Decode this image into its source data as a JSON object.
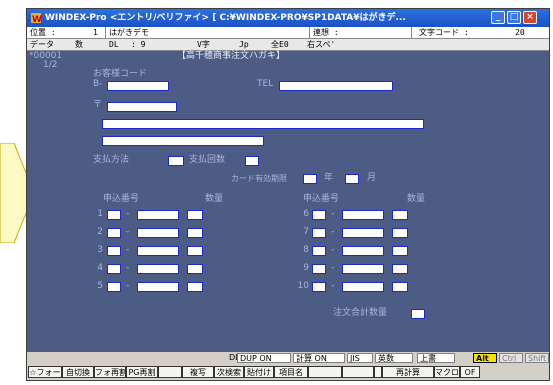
{
  "window": {
    "title": "WINDEX-Pro <エントリ/ベリファイ> [ C:¥WINDEX-PRO¥SP1DATA¥はがきデ...",
    "min": "_",
    "max": "□",
    "close": "×"
  },
  "header_row1": {
    "pos_label": "位置 :",
    "pos_value": "1",
    "pos_name": "はがきデモ",
    "link_label": "連想 :",
    "code_label": "文字コード :",
    "code_value": "20"
  },
  "header_row2": {
    "data_label": "データ",
    "count_label": "数",
    "dl_label": "DL",
    "dl_value": ": 9",
    "v_label": "V字",
    "jp_label": "Jp",
    "zen_label": "全E0",
    "right_label": "右スペ'"
  },
  "record": {
    "id": "*00001",
    "page": "1/2"
  },
  "form": {
    "title": "【高千穂商事注文ハガキ】",
    "customer_code_label": "お客様コード",
    "b_label": "B-",
    "tel_label": "TEL",
    "postal_label": "〒",
    "payment_method_label": "支払方法",
    "payment_count_label": "支払回数",
    "card_label": "カード有効期限",
    "year_label": "年",
    "month_label": "月",
    "order_no_label": "申込番号",
    "qty_label": "数量",
    "total_label": "注文合計数量",
    "dash": "-",
    "rows_left": [
      "1",
      "2",
      "3",
      "4",
      "5"
    ],
    "rows_right": [
      "6",
      "7",
      "8",
      "9",
      "10"
    ]
  },
  "status": {
    "dl": "DL",
    "dup": "DUP ON",
    "calc": "計算 ON",
    "jis": "JIS",
    "eisu": "英数",
    "overwrite": "上書",
    "alt": "Alt",
    "ctrl": "Ctrl",
    "shift": "Shift"
  },
  "fkeys": [
    "☆フォー",
    "自切換",
    "フォ再割",
    "PG再割",
    "",
    "複写",
    "次検索",
    "貼付け",
    "項目名",
    "",
    "",
    "",
    "再計算",
    "マクロ",
    "OF"
  ]
}
